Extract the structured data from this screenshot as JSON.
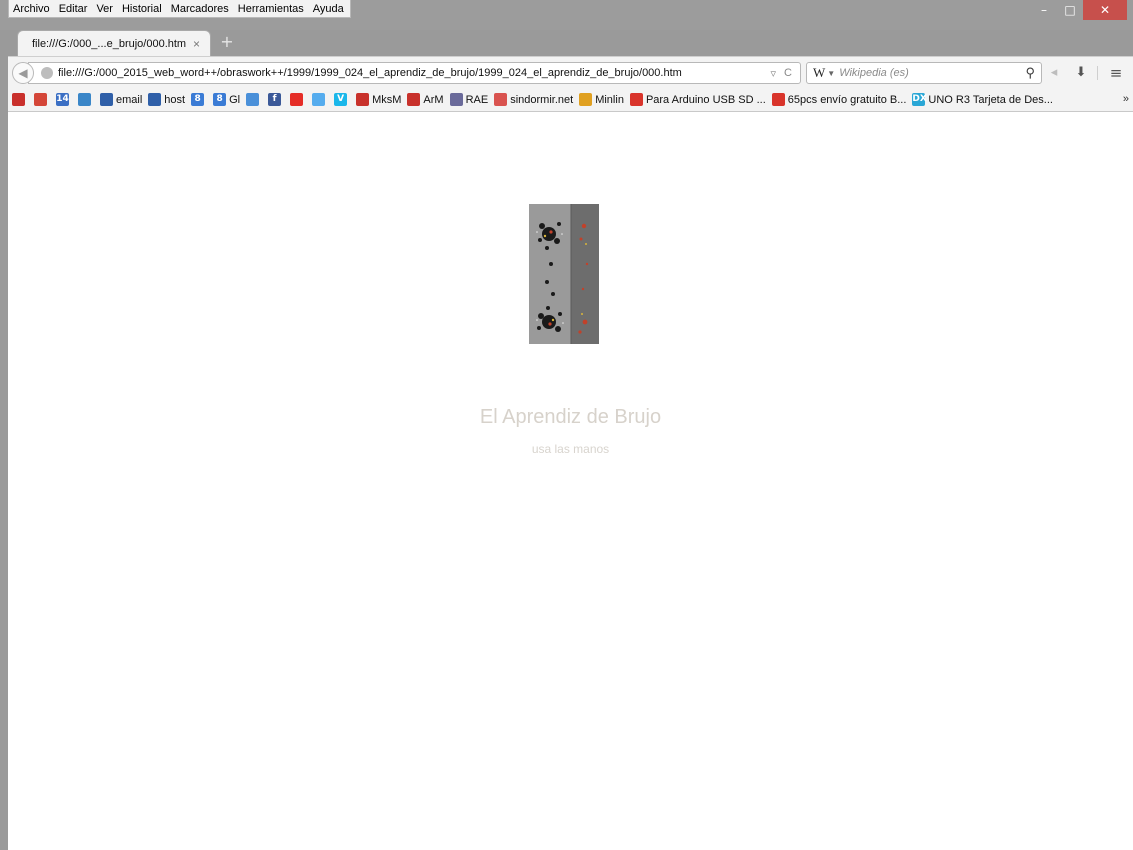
{
  "menubar": {
    "items": [
      "Archivo",
      "Editar",
      "Ver",
      "Historial",
      "Marcadores",
      "Herramientas",
      "Ayuda"
    ]
  },
  "window_controls": {
    "minimize": "–",
    "maximize": "□",
    "close": "✕"
  },
  "tab": {
    "title": "file:///G:/000_...e_brujo/000.htm",
    "close": "×",
    "new_tab": "+"
  },
  "navbar": {
    "url": "file:///G:/000_2015_web_word++/obraswork++/1999/1999_024_el_aprendiz_de_brujo/1999_024_el_aprendiz_de_brujo/000.htm",
    "search_engine": "W",
    "search_placeholder": "Wikipedia (es)"
  },
  "bookmarks": [
    {
      "label": "",
      "icon": "pocket-icon",
      "color": "#c9302c"
    },
    {
      "label": "",
      "icon": "gmail-icon",
      "color": "#d44638"
    },
    {
      "label": "",
      "icon": "calendar-icon",
      "color": "#3b6fc4",
      "glyph": "14"
    },
    {
      "label": "",
      "icon": "reader-icon",
      "color": "#3a86c8"
    },
    {
      "label": "email",
      "icon": "mail-icon",
      "color": "#2f5fa8"
    },
    {
      "label": "host",
      "icon": "host-icon",
      "color": "#2f5fa8"
    },
    {
      "label": "",
      "icon": "google-plus-icon",
      "color": "#3a7bd5",
      "glyph": "8"
    },
    {
      "label": "Gl",
      "icon": "google-plus-icon",
      "color": "#3a7bd5",
      "glyph": "8"
    },
    {
      "label": "",
      "icon": "translate-icon",
      "color": "#4a90d9"
    },
    {
      "label": "",
      "icon": "facebook-icon",
      "color": "#3b5998",
      "glyph": "f"
    },
    {
      "label": "",
      "icon": "youtube-icon",
      "color": "#e52d27"
    },
    {
      "label": "",
      "icon": "twitter-icon",
      "color": "#55acee"
    },
    {
      "label": "",
      "icon": "vimeo-icon",
      "color": "#1ab7ea",
      "glyph": "V"
    },
    {
      "label": "MksM",
      "icon": "flag-icon",
      "color": "#c8312b"
    },
    {
      "label": "ArM",
      "icon": "flag-icon",
      "color": "#c8312b"
    },
    {
      "label": "RAE",
      "icon": "rae-icon",
      "color": "#6a6a9a"
    },
    {
      "label": "sindormir.net",
      "icon": "sindormir-icon",
      "color": "#d9534f"
    },
    {
      "label": "Minlin",
      "icon": "minlin-icon",
      "color": "#e0a020"
    },
    {
      "label": "Para Arduino USB SD ...",
      "icon": "store-icon",
      "color": "#d9342b"
    },
    {
      "label": "65pcs envío gratuito B...",
      "icon": "store-icon",
      "color": "#d9342b"
    },
    {
      "label": "UNO R3 Tarjeta de Des...",
      "icon": "dx-icon",
      "color": "#2aa7d6",
      "glyph": "DX"
    }
  ],
  "page": {
    "title": "El Aprendiz de Brujo",
    "subtitle": "usa las manos"
  }
}
